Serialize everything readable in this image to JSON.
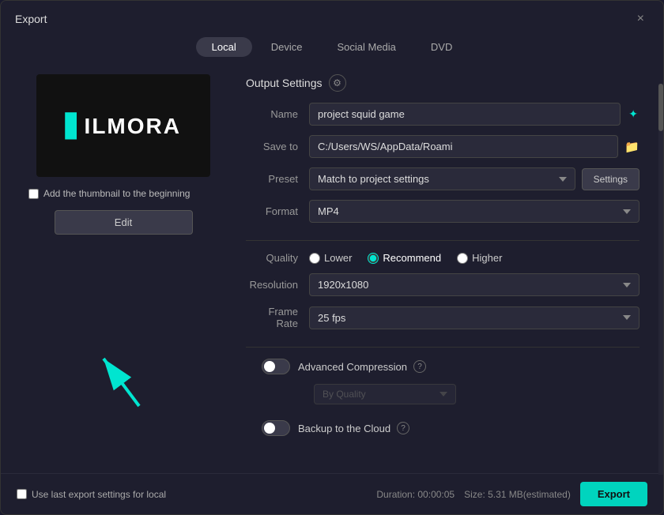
{
  "dialog": {
    "title": "Export",
    "close_label": "×"
  },
  "tabs": [
    {
      "id": "local",
      "label": "Local",
      "active": true
    },
    {
      "id": "device",
      "label": "Device",
      "active": false
    },
    {
      "id": "social-media",
      "label": "Social Media",
      "active": false
    },
    {
      "id": "dvd",
      "label": "DVD",
      "active": false
    }
  ],
  "output_settings": {
    "header": "Output Settings",
    "name_label": "Name",
    "name_value": "project squid game",
    "save_to_label": "Save to",
    "save_to_value": "C:/Users/WS/AppData/Roami",
    "preset_label": "Preset",
    "preset_value": "Match to project settings",
    "settings_btn_label": "Settings",
    "format_label": "Format",
    "format_value": "MP4",
    "quality_label": "Quality",
    "quality_options": [
      {
        "id": "lower",
        "label": "Lower",
        "checked": false
      },
      {
        "id": "recommend",
        "label": "Recommend",
        "checked": true
      },
      {
        "id": "higher",
        "label": "Higher",
        "checked": false
      }
    ],
    "resolution_label": "Resolution",
    "resolution_value": "1920x1080",
    "frame_rate_label": "Frame Rate",
    "frame_rate_value": "25 fps",
    "advanced_compression_label": "Advanced Compression",
    "advanced_compression_on": false,
    "by_quality_label": "By Quality",
    "backup_cloud_label": "Backup to the Cloud",
    "backup_cloud_on": false
  },
  "thumbnail": {
    "logo_text": "FILMORA",
    "add_label": "Add the thumbnail to the beginning",
    "edit_label": "Edit"
  },
  "footer": {
    "use_last_label": "Use last export settings for local",
    "duration_label": "Duration: 00:00:05",
    "size_label": "Size: 5.31 MB(estimated)",
    "export_label": "Export"
  }
}
